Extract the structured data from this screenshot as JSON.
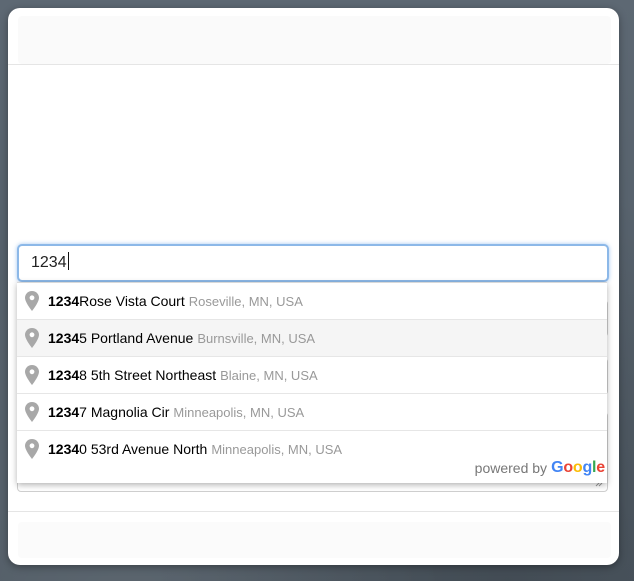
{
  "address_input": {
    "value": "1234"
  },
  "suggestions": [
    {
      "match": "1234",
      "rest": " Rose Vista Court",
      "secondary": "Roseville, MN, USA"
    },
    {
      "match": "1234",
      "rest": "5 Portland Avenue",
      "secondary": "Burnsville, MN, USA"
    },
    {
      "match": "1234",
      "rest": "8 5th Street Northeast",
      "secondary": "Blaine, MN, USA"
    },
    {
      "match": "1234",
      "rest": "7 Magnolia Cir",
      "secondary": "Minneapolis, MN, USA"
    },
    {
      "match": "1234",
      "rest": "0 53rd Avenue North",
      "secondary": "Minneapolis, MN, USA"
    }
  ],
  "attribution": {
    "powered_by": "powered by",
    "logo_letters": [
      "G",
      "o",
      "o",
      "g",
      "l",
      "e"
    ]
  },
  "icons": {
    "suggestion_icon": "map-pin-icon"
  },
  "colors": {
    "backdrop": "#57626d",
    "focus_border": "#8cb8e8",
    "match_text": "#000000",
    "secondary_text": "#999999",
    "google_blue": "#4285f4",
    "google_red": "#ea4335",
    "google_yellow": "#fbbc05",
    "google_green": "#34a853"
  }
}
